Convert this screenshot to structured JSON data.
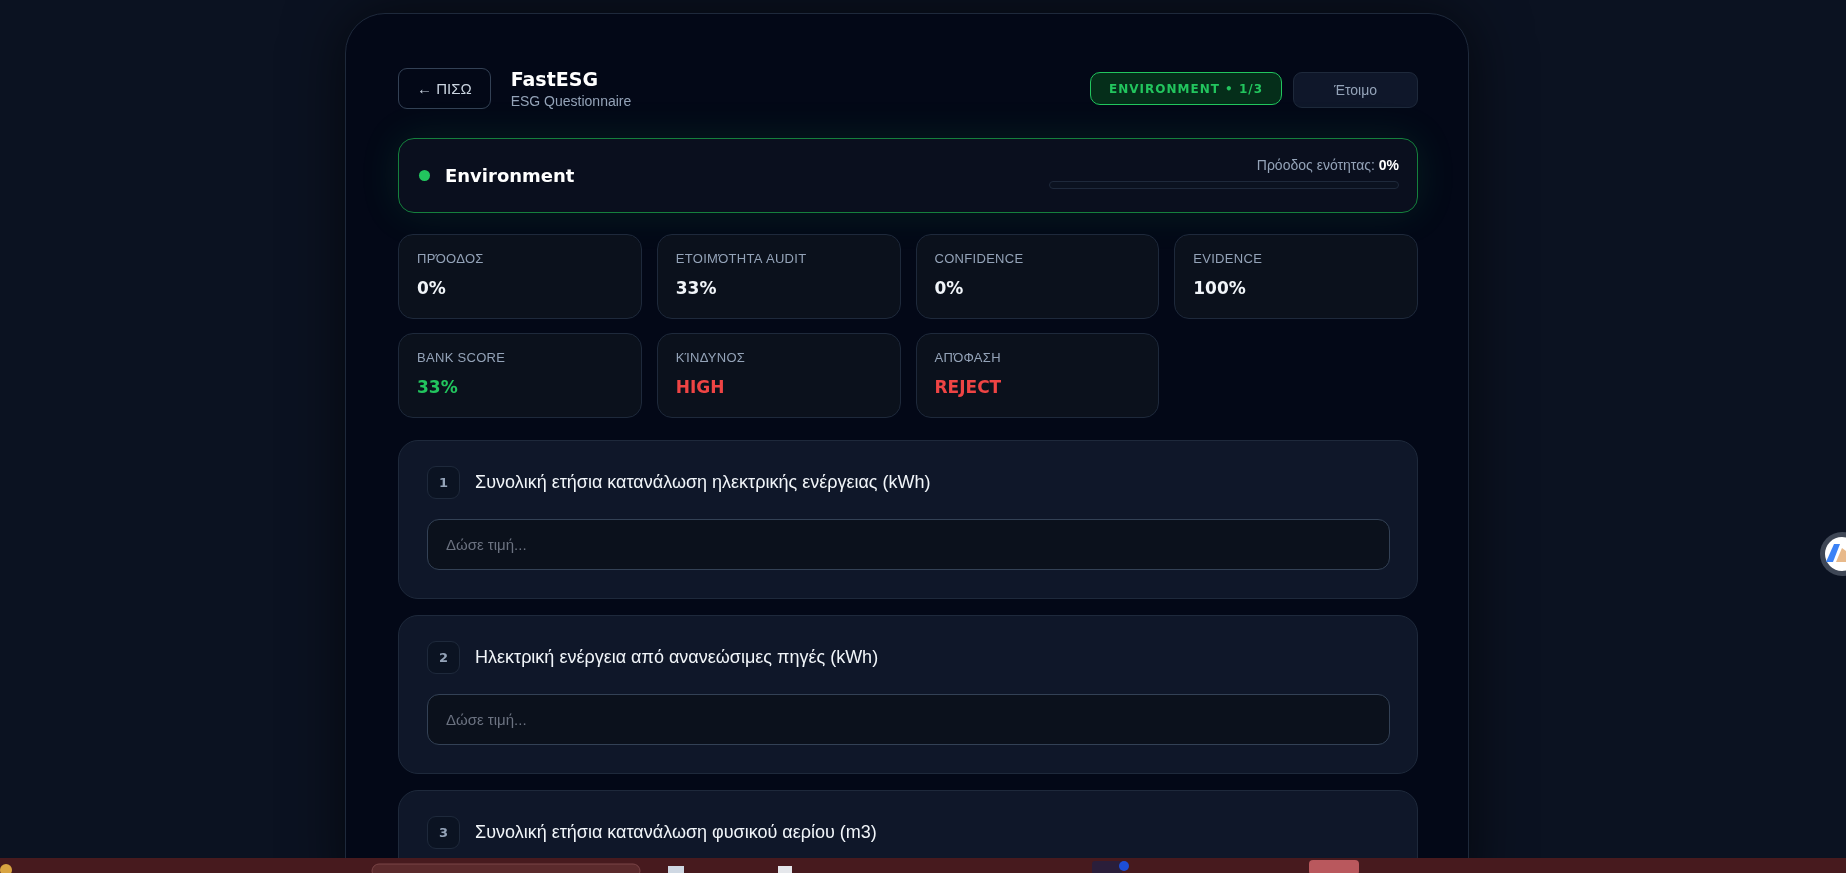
{
  "header": {
    "back_button": "← ΠΙΣΩ",
    "title": "FastESG",
    "subtitle": "ESG Questionnaire",
    "section_badge": "ENVIRONMENT • 1/3",
    "status_button": "Έτοιμο"
  },
  "section": {
    "name": "Environment",
    "color": "#22c55e",
    "progress_label": "Πρόοδος ενότητας:",
    "progress_value": "0%",
    "level": 0
  },
  "metrics": [
    {
      "label": "ΠΡΌΟΔΟΣ",
      "value": "0%",
      "color": "#f1f5f9"
    },
    {
      "label": "ΕΤΟΙΜΌΤΗΤΑ AUDIT",
      "value": "33%",
      "color": "#f1f5f9"
    },
    {
      "label": "CONFIDENCE",
      "value": "0%",
      "color": "#f1f5f9"
    },
    {
      "label": "EVIDENCE",
      "value": "100%",
      "color": "#f1f5f9"
    },
    {
      "label": "BANK SCORE",
      "value": "33%",
      "color": "#22c55e"
    },
    {
      "label": "ΚΊΝΔΥΝΟΣ",
      "value": "HIGH",
      "color": "#ef4444"
    },
    {
      "label": "ΑΠΌΦΑΣΗ",
      "value": "REJECT",
      "color": "#ef4444"
    }
  ],
  "questions": [
    {
      "number": "1",
      "text": "Συνολική ετήσια κατανάλωση ηλεκτρικής ενέργειας (kWh)",
      "placeholder": "Δώσε τιμή..."
    },
    {
      "number": "2",
      "text": "Ηλεκτρική ενέργεια από ανανεώσιμες πηγές (kWh)",
      "placeholder": "Δώσε τιμή..."
    },
    {
      "number": "3",
      "text": "Συνολική ετήσια κατανάλωση φυσικού αερίου (m3)"
    }
  ]
}
